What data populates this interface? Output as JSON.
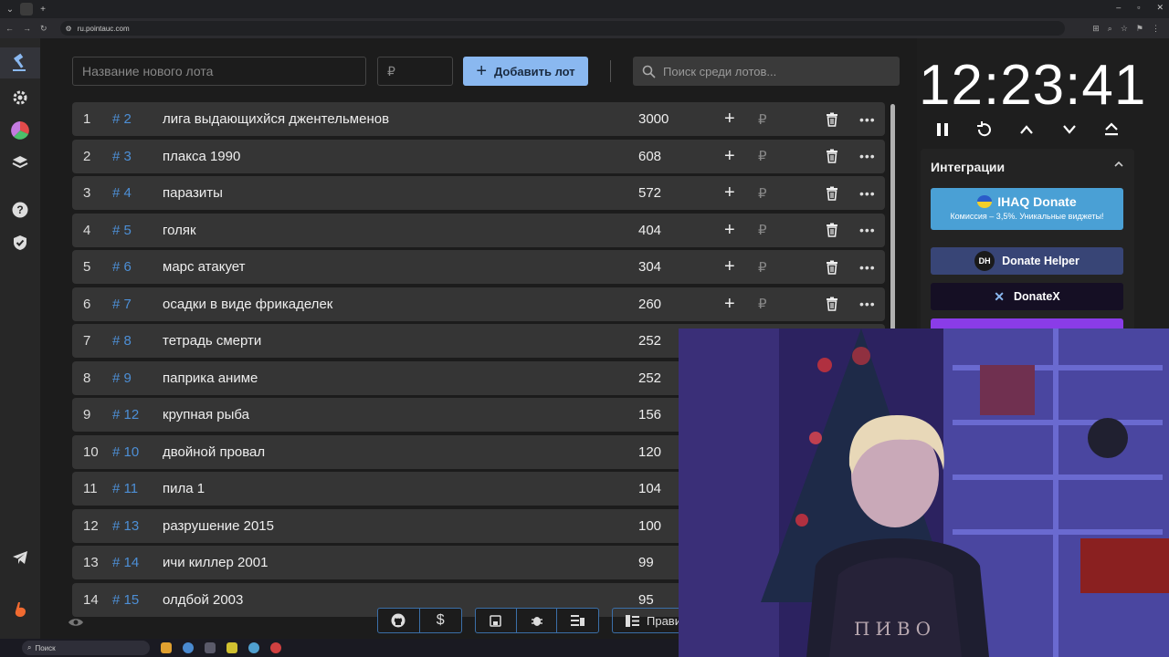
{
  "browser": {
    "url": "ru.pointauc.com"
  },
  "toolbar": {
    "lot_name_placeholder": "Название нового лота",
    "amount_placeholder": "₽",
    "add_lot_label": "Добавить лот",
    "search_placeholder": "Поиск среди лотов..."
  },
  "lots": [
    {
      "num": "1",
      "id": "# 2",
      "name": "лига выдающихйся джентельменов",
      "amount": "3000"
    },
    {
      "num": "2",
      "id": "# 3",
      "name": "плакса 1990",
      "amount": "608"
    },
    {
      "num": "3",
      "id": "# 4",
      "name": "паразиты",
      "amount": "572"
    },
    {
      "num": "4",
      "id": "# 5",
      "name": "голяк",
      "amount": "404"
    },
    {
      "num": "5",
      "id": "# 6",
      "name": "марс атакует",
      "amount": "304"
    },
    {
      "num": "6",
      "id": "# 7",
      "name": "осадки в виде фрикаделек",
      "amount": "260"
    },
    {
      "num": "7",
      "id": "# 8",
      "name": "тетрадь смерти",
      "amount": "252"
    },
    {
      "num": "8",
      "id": "# 9",
      "name": "паприка аниме",
      "amount": "252"
    },
    {
      "num": "9",
      "id": "# 12",
      "name": "крупная рыба",
      "amount": "156"
    },
    {
      "num": "10",
      "id": "# 10",
      "name": " двойной провал",
      "amount": "120"
    },
    {
      "num": "11",
      "id": "# 11",
      "name": "пила 1",
      "amount": "104"
    },
    {
      "num": "12",
      "id": "# 13",
      "name": "разрушение 2015",
      "amount": "100"
    },
    {
      "num": "13",
      "id": "# 14",
      "name": "ичи киллер 2001",
      "amount": "99"
    },
    {
      "num": "14",
      "id": "# 15",
      "name": "олдбой 2003",
      "amount": "95"
    }
  ],
  "row_controls": {
    "currency": "₽",
    "more": "•••"
  },
  "timer": {
    "time": "12:23:41"
  },
  "integrations": {
    "title": "Интеграции",
    "ihaq_title": "IHAQ Donate",
    "ihaq_sub": "Комиссия – 3,5%. Уникальные виджеты!",
    "donate_helper_logo": "DH",
    "donate_helper": "Donate Helper",
    "donatex": "DonateX"
  },
  "bottom": {
    "rules_label": "Прави"
  },
  "taskbar": {
    "search_label": "Поиск"
  },
  "webcam": {
    "shirt_text": "ПИВО"
  },
  "colors": {
    "accent": "#8ab8f0",
    "lot_id": "#4d8fd6",
    "row_bg": "#353535",
    "ihaq": "#4aa0d5"
  }
}
